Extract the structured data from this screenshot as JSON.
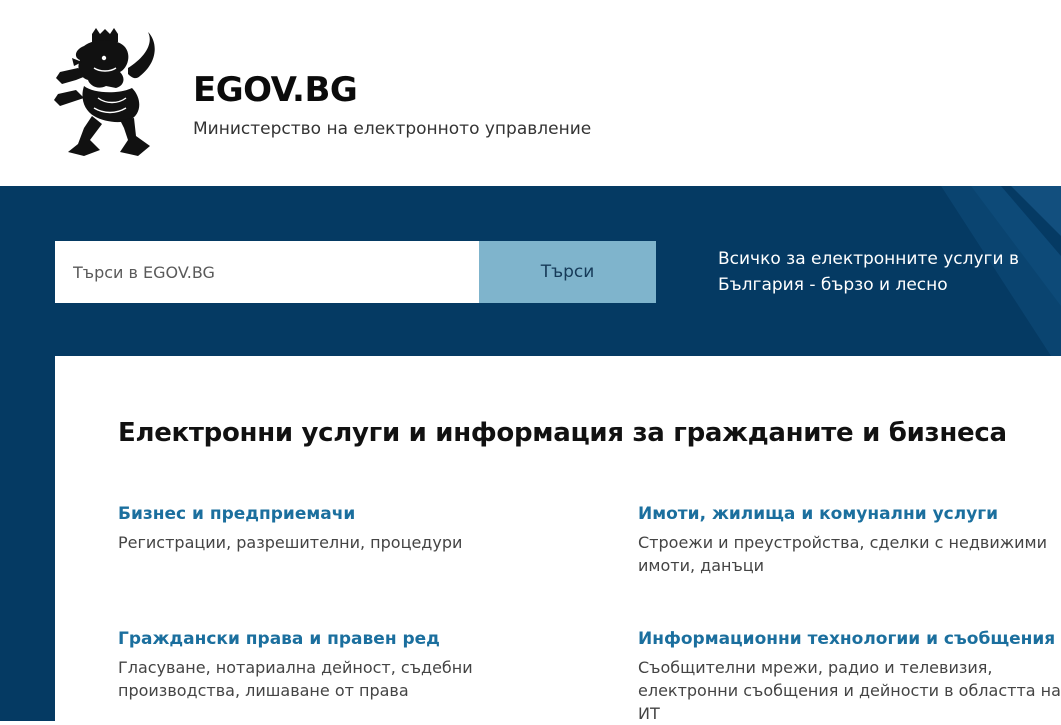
{
  "header": {
    "title": "EGOV.BG",
    "subtitle": "Министерство на електронното управление",
    "logo_icon": "coat-of-arms-lion"
  },
  "hero": {
    "search_placeholder": "Търси в EGOV.BG",
    "search_value": "",
    "search_button": "Търси",
    "tagline": "Всичко за електронните услуги в България - бързо и лесно"
  },
  "main": {
    "title": "Електронни услуги и информация за гражданите и бизнеса",
    "categories": [
      {
        "title": "Бизнес и предприемачи",
        "description": "Регистрации, разрешителни, процедури"
      },
      {
        "title": "Имоти, жилища и комунални услуги",
        "description": "Строежи и преустройства, сделки с недвижими имоти, данъци"
      },
      {
        "title": "Граждански права и правен ред",
        "description": "Гласуване, нотариална дейност, съдебни производства, лишаване от права"
      },
      {
        "title": "Информационни технологии и съобщения",
        "description": "Съобщителни мрежи, радио и телевизия, електронни съобщения и дейности в областта на ИТ"
      }
    ]
  },
  "colors": {
    "brand_dark_blue": "#053a63",
    "search_button_bg": "#7fb4cc",
    "link_blue": "#1b6f9e"
  }
}
